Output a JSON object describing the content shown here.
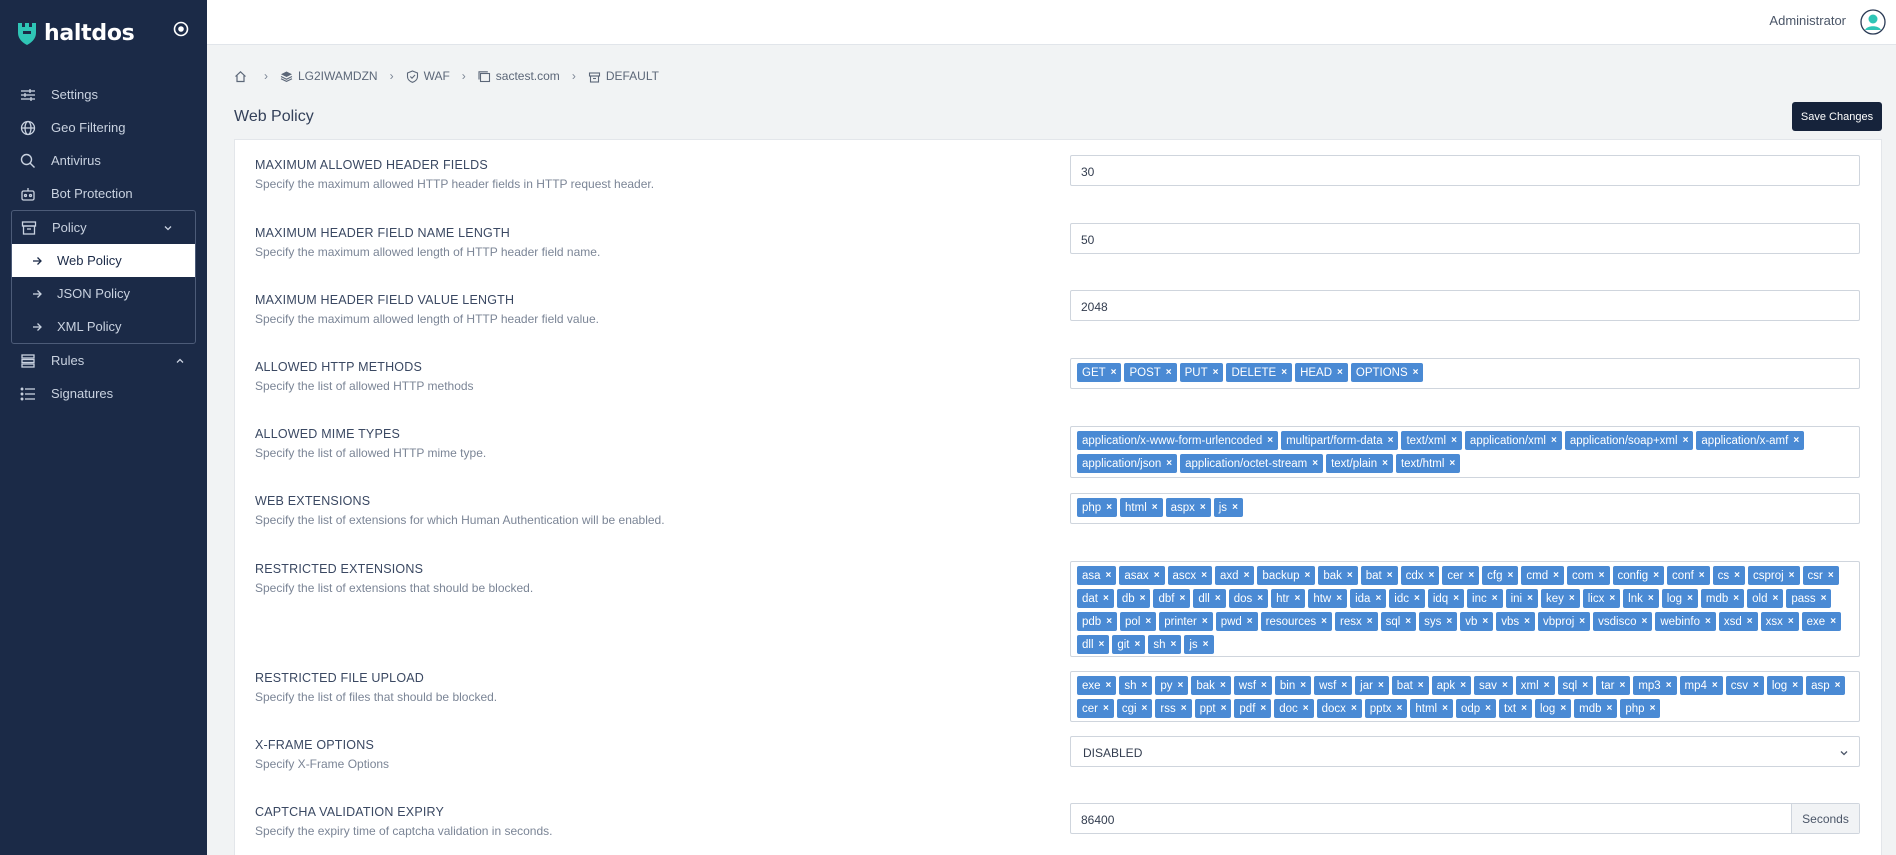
{
  "brand": {
    "name": "haltdos"
  },
  "sidebar": {
    "items": [
      {
        "label": "Settings",
        "icon": "sliders-icon"
      },
      {
        "label": "Geo Filtering",
        "icon": "globe-icon"
      },
      {
        "label": "Antivirus",
        "icon": "search-icon"
      },
      {
        "label": "Bot Protection",
        "icon": "bot-icon"
      }
    ],
    "policy": {
      "label": "Policy",
      "children": [
        {
          "label": "Web Policy",
          "active": true
        },
        {
          "label": "JSON Policy"
        },
        {
          "label": "XML Policy"
        }
      ]
    },
    "rules": {
      "label": "Rules"
    },
    "signatures": {
      "label": "Signatures"
    }
  },
  "header": {
    "user": "Administrator"
  },
  "breadcrumb": [
    {
      "label": "",
      "icon": "home-icon"
    },
    {
      "label": "LG2IWAMDZN",
      "icon": "layers-icon"
    },
    {
      "label": "WAF",
      "icon": "shield-icon"
    },
    {
      "label": "sactest.com",
      "icon": "window-icon"
    },
    {
      "label": "DEFAULT",
      "icon": "archive-icon"
    }
  ],
  "page": {
    "title": "Web Policy",
    "save_label": "Save Changes"
  },
  "fields": {
    "max_header_fields": {
      "title": "MAXIMUM ALLOWED HEADER FIELDS",
      "desc": "Specify the maximum allowed HTTP header fields in HTTP request header.",
      "value": "30"
    },
    "max_name_length": {
      "title": "MAXIMUM HEADER FIELD NAME LENGTH",
      "desc": "Specify the maximum allowed length of HTTP header field name.",
      "value": "50"
    },
    "max_value_length": {
      "title": "MAXIMUM HEADER FIELD VALUE LENGTH",
      "desc": "Specify the maximum allowed length of HTTP header field value.",
      "value": "2048"
    },
    "http_methods": {
      "title": "ALLOWED HTTP METHODS",
      "desc": "Specify the list of allowed HTTP methods",
      "tags": [
        "GET",
        "POST",
        "PUT",
        "DELETE",
        "HEAD",
        "OPTIONS"
      ]
    },
    "mime_types": {
      "title": "ALLOWED MIME TYPES",
      "desc": "Specify the list of allowed HTTP mime type.",
      "tags": [
        "application/x-www-form-urlencoded",
        "multipart/form-data",
        "text/xml",
        "application/xml",
        "application/soap+xml",
        "application/x-amf",
        "application/json",
        "application/octet-stream",
        "text/plain",
        "text/html"
      ]
    },
    "web_extensions": {
      "title": "WEB EXTENSIONS",
      "desc": "Specify the list of extensions for which Human Authentication will be enabled.",
      "tags": [
        "php",
        "html",
        "aspx",
        "js"
      ]
    },
    "restricted_extensions": {
      "title": "RESTRICTED EXTENSIONS",
      "desc": "Specify the list of extensions that should be blocked.",
      "tags": [
        "asa",
        "asax",
        "ascx",
        "axd",
        "backup",
        "bak",
        "bat",
        "cdx",
        "cer",
        "cfg",
        "cmd",
        "com",
        "config",
        "conf",
        "cs",
        "csproj",
        "csr",
        "dat",
        "db",
        "dbf",
        "dll",
        "dos",
        "htr",
        "htw",
        "ida",
        "idc",
        "idq",
        "inc",
        "ini",
        "key",
        "licx",
        "lnk",
        "log",
        "mdb",
        "old",
        "pass",
        "pdb",
        "pol",
        "printer",
        "pwd",
        "resources",
        "resx",
        "sql",
        "sys",
        "vb",
        "vbs",
        "vbproj",
        "vsdisco",
        "webinfo",
        "xsd",
        "xsx",
        "exe",
        "dll",
        "git",
        "sh",
        "js"
      ]
    },
    "restricted_upload": {
      "title": "RESTRICTED FILE UPLOAD",
      "desc": "Specify the list of files that should be blocked.",
      "tags": [
        "exe",
        "sh",
        "py",
        "bak",
        "wsf",
        "bin",
        "wsf",
        "jar",
        "bat",
        "apk",
        "sav",
        "xml",
        "sql",
        "tar",
        "mp3",
        "mp4",
        "csv",
        "log",
        "asp",
        "cer",
        "cgi",
        "rss",
        "ppt",
        "pdf",
        "doc",
        "docx",
        "pptx",
        "html",
        "odp",
        "txt",
        "log",
        "mdb",
        "php"
      ]
    },
    "x_frame": {
      "title": "X-FRAME OPTIONS",
      "desc": "Specify X-Frame Options",
      "value": "DISABLED"
    },
    "captcha_expiry": {
      "title": "CAPTCHA VALIDATION EXPIRY",
      "desc": "Specify the expiry time of captcha validation in seconds.",
      "value": "86400",
      "unit": "Seconds"
    }
  },
  "colors": {
    "sidebar": "#1b2a47",
    "tag": "#4a8ad4",
    "button": "#16233b"
  }
}
